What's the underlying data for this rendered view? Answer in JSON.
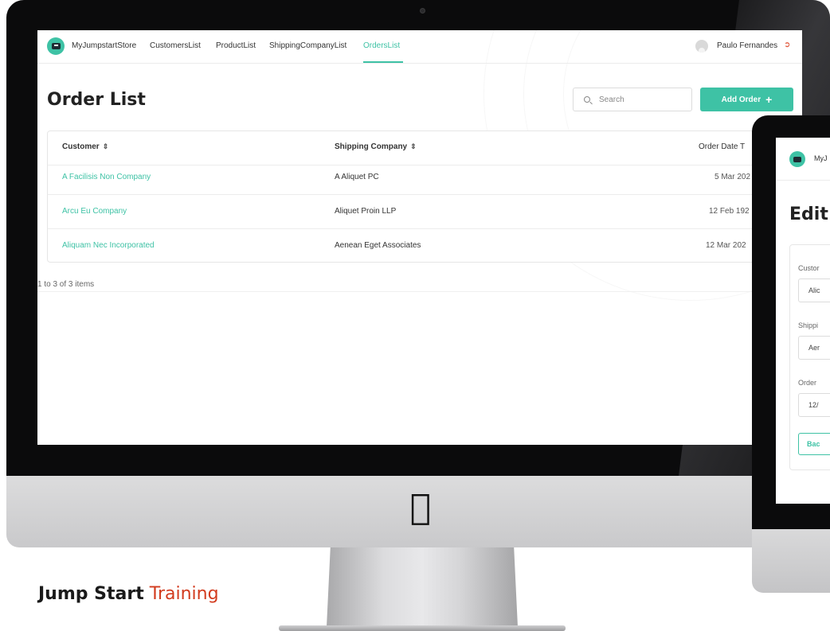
{
  "navbar": {
    "brand": "MyJumpstartStore",
    "links": [
      "CustomersList",
      "ProductList",
      "ShippingCompanyList",
      "OrdersList"
    ],
    "active_link": "OrdersList",
    "user_name": "Paulo Fernandes"
  },
  "page": {
    "title": "Order List",
    "search_placeholder": "Search",
    "add_button_label": "Add Order"
  },
  "table": {
    "columns": [
      "Customer",
      "Shipping Company",
      "Order Date T"
    ],
    "rows": [
      {
        "customer": "A Facilisis Non Company",
        "shipping_company": "A Aliquet PC",
        "order_date": "5 Mar 202"
      },
      {
        "customer": "Arcu Eu Company",
        "shipping_company": "Aliquet Proin LLP",
        "order_date": "12 Feb 192"
      },
      {
        "customer": "Aliquam Nec Incorporated",
        "shipping_company": "Aenean Eget Associates",
        "order_date": "12 Mar 202"
      }
    ],
    "pagination": "1 to 3 of 3 items"
  },
  "second_screen": {
    "brand": "MyJ",
    "title": "Edit",
    "fields": [
      {
        "label": "Custor",
        "value": "Alic"
      },
      {
        "label": "Shippi",
        "value": "Aer"
      },
      {
        "label": "Order",
        "value": "12/"
      }
    ],
    "back_button": "Bac"
  },
  "caption": {
    "bold": "Jump Start",
    "accent": "Training"
  },
  "colors": {
    "accent": "#3ec2a5",
    "caption_accent": "#d23b1e"
  }
}
